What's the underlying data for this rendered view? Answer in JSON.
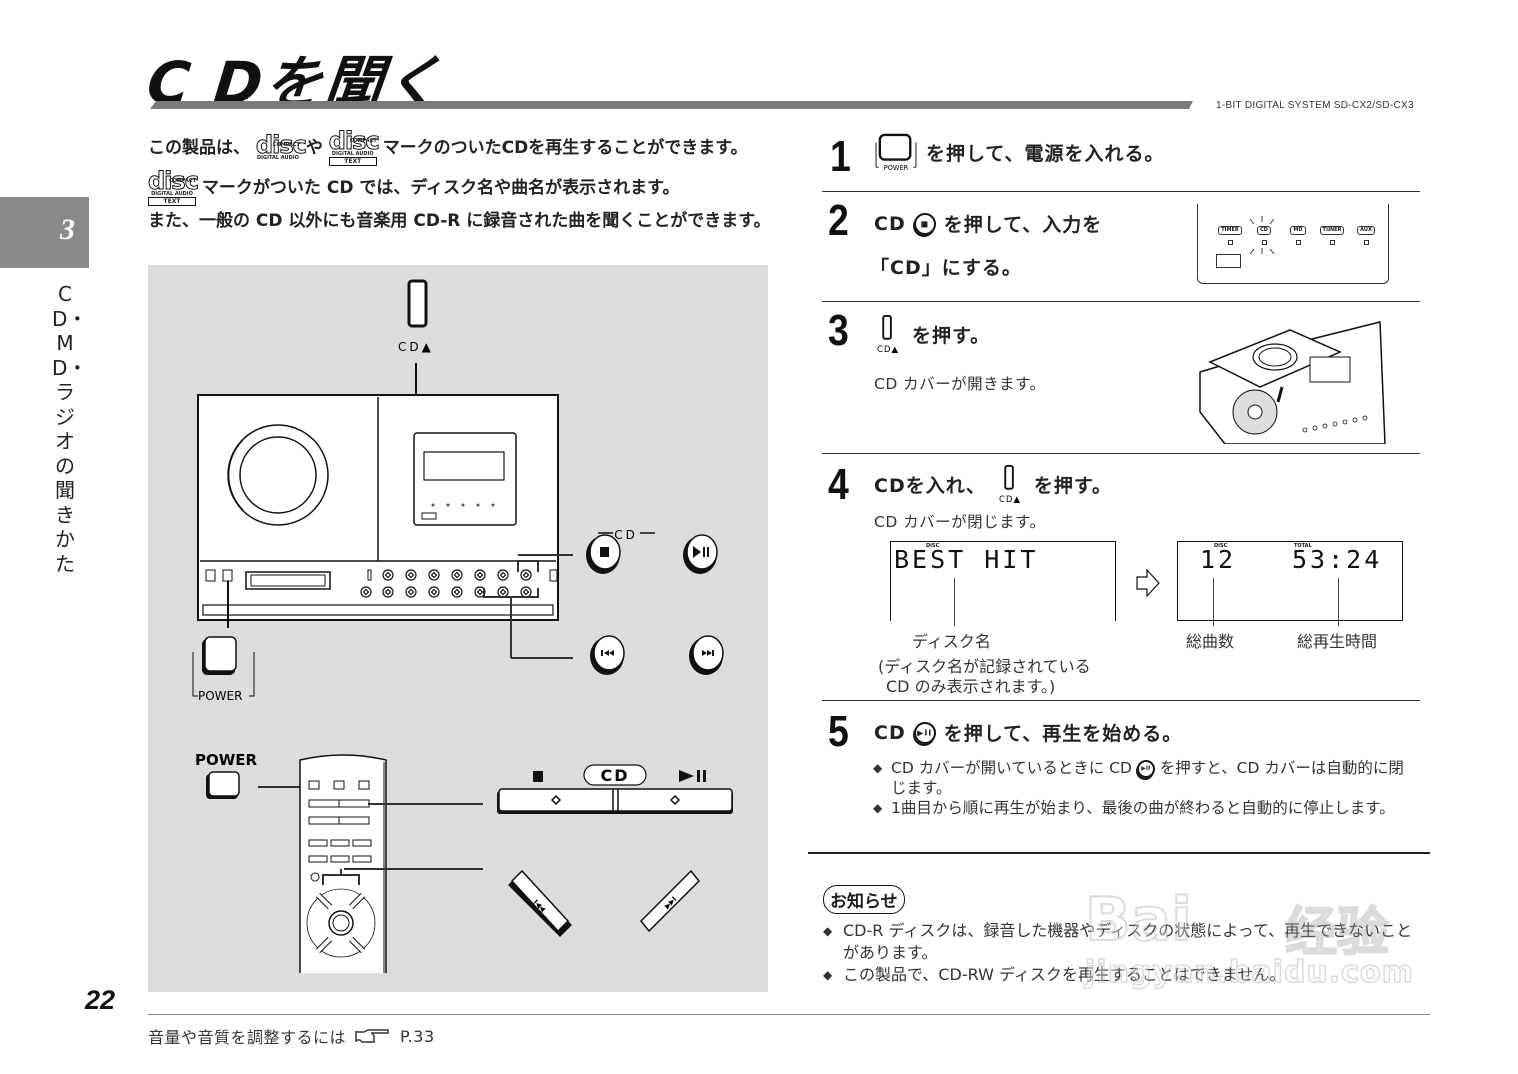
{
  "header": {
    "title": "C Dを聞く",
    "model": "1-BIT DIGITAL SYSTEM SD-CX2/SD-CX3"
  },
  "chapter": {
    "number": "3",
    "label": "CD・MD・ラジオの聞きかた"
  },
  "intro": {
    "line1_a": "この製品は、",
    "line1_b": "や",
    "line1_c": "マークのついたCDを再生することができます。",
    "line2": "マークがついた CD では、ディスク名や曲名が表示されます。",
    "line3": "また、一般の CD 以外にも音楽用 CD-R に録音された曲を聞くことができます。",
    "logo": {
      "compact": "COMPACT",
      "disc": "disc",
      "digital_audio": "DIGITAL AUDIO",
      "text": "TEXT"
    }
  },
  "illustration": {
    "cd_eject_label": "CD▲",
    "cd_group_label": "CD",
    "power_label": "POWER",
    "remote_power_label": "POWER",
    "remote_cd_label": "CD",
    "stop_symbol": "■",
    "play_pause_symbol": "▶II",
    "prev_symbol": "I◀◀",
    "next_symbol": "▶▶I"
  },
  "steps": [
    {
      "num": "1",
      "text": "を押して、電源を入れる。",
      "icon_label": "POWER"
    },
    {
      "num": "2",
      "text_a": "CD",
      "text_b": "を押して、入力を",
      "text_c": "「CD」にする。",
      "indicators": [
        "TIMER",
        "CD",
        "MD",
        "TUNER",
        "AUX"
      ],
      "active_indicator": "CD"
    },
    {
      "num": "3",
      "text": "を押す。",
      "icon_label": "CD▲",
      "sub": "CD カバーが開きます。"
    },
    {
      "num": "4",
      "text_a": "CDを入れ、",
      "text_b": "を押す。",
      "icon_label": "CD▲",
      "sub": "CD カバーが閉じます。",
      "display1": {
        "tag": "DISC",
        "text": "BEST HIT",
        "caption": "ディスク名",
        "note_1": "(ディスク名が記録されている",
        "note_2": "CD のみ表示されます。)"
      },
      "display2": {
        "tag_disc": "DISC",
        "tag_total": "TOTAL",
        "tracks": "12",
        "time": "53:24",
        "caption_tracks": "総曲数",
        "caption_time": "総再生時間"
      }
    },
    {
      "num": "5",
      "text_a": "CD",
      "text_b": "を押して、再生を始める。",
      "bullets": [
        {
          "a": "CD カバーが開いているときに CD",
          "b": "を押すと、CD カバーは自動的に閉じます。"
        },
        {
          "a": "1曲目から順に再生が始まり、最後の曲が終わると自動的に停止します。"
        }
      ]
    }
  ],
  "notice": {
    "title": "お知らせ",
    "items": [
      "CD-R ディスクは、録音した機器やディスクの状態によって、再生できないことがあります。",
      "この製品で、CD-RW ディスクを再生することはできません。"
    ]
  },
  "footer": {
    "page_number": "22",
    "ref_text": "音量や音質を調整するには",
    "ref_page": "P.33"
  },
  "bullet_mark": "◆",
  "watermark": {
    "brand": "Bai",
    "suffix": "经验",
    "url": "jingyan.baidu.com"
  }
}
